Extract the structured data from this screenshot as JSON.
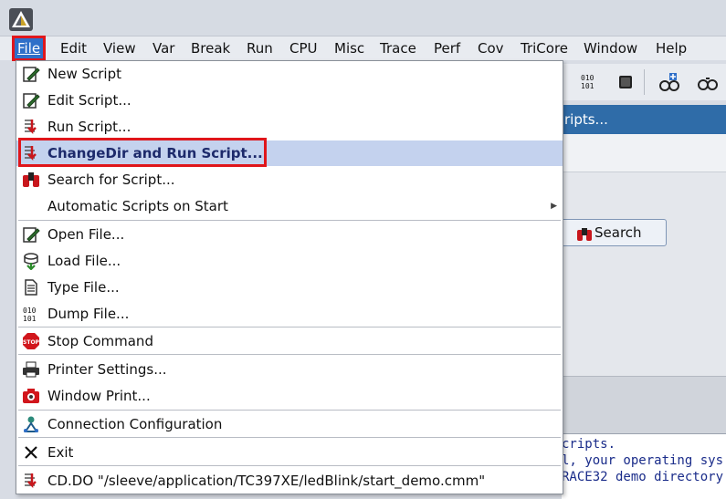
{
  "menubar": {
    "items": [
      {
        "label": "File",
        "ul": "F"
      },
      {
        "label": "Edit",
        "ul": "E"
      },
      {
        "label": "View",
        "ul": "V"
      },
      {
        "label": "Var",
        "ul": "r"
      },
      {
        "label": "Break",
        "ul": "B"
      },
      {
        "label": "Run",
        "ul": "R"
      },
      {
        "label": "CPU",
        "ul": "C"
      },
      {
        "label": "Misc",
        "ul": "M"
      },
      {
        "label": "Trace",
        "ul": "T"
      },
      {
        "label": "Perf",
        "ul": "P"
      },
      {
        "label": "Cov",
        "ul": "o"
      },
      {
        "label": "TriCore",
        "ul": ""
      },
      {
        "label": "Window",
        "ul": "W"
      },
      {
        "label": "Help",
        "ul": "H"
      }
    ]
  },
  "toolbar": {
    "dump_icon_text": "010\n101"
  },
  "background": {
    "subwindow_title": "ripts...",
    "search_button": "Search",
    "console_lines": [
      "cripts.",
      "l, your operating sys",
      "RACE32 demo directory"
    ]
  },
  "file_menu": {
    "items": [
      {
        "label": "New Script",
        "ul": "N",
        "icon": "edit-pencil-icon"
      },
      {
        "label": "Edit Script...",
        "ul": "E",
        "icon": "edit-pencil-icon"
      },
      {
        "label": "Run Script...",
        "ul": "R",
        "icon": "run-script-icon"
      },
      {
        "label": "ChangeDir and Run Script...",
        "ul": "C",
        "icon": "run-script-icon",
        "selected": true
      },
      {
        "label": "Search for Script...",
        "ul": "S",
        "icon": "binoculars-icon"
      },
      {
        "label": "Automatic Scripts on Start",
        "ul": "",
        "icon": "",
        "submenu": true
      },
      {
        "label": "Open File...",
        "ul": "",
        "icon": "edit-pencil-icon"
      },
      {
        "label": "Load File...",
        "ul": "L",
        "icon": "load-file-icon"
      },
      {
        "label": "Type File...",
        "ul": "T",
        "icon": "type-file-icon"
      },
      {
        "label": "Dump File...",
        "ul": "u",
        "icon": "dump-file-icon"
      },
      {
        "label": "Stop Command",
        "ul": "",
        "icon": "stop-icon"
      },
      {
        "label": "Printer Settings...",
        "ul": "",
        "icon": "printer-icon"
      },
      {
        "label": "Window Print...",
        "ul": "",
        "icon": "camera-icon"
      },
      {
        "label": "Connection Configuration",
        "ul": "",
        "icon": "connection-icon"
      },
      {
        "label": "Exit",
        "ul": "x",
        "icon": "close-icon"
      },
      {
        "label": "CD.DO \"/sleeve/application/TC397XE/ledBlink/start_demo.cmm\"",
        "ul": "",
        "icon": "run-script-icon"
      }
    ]
  },
  "colors": {
    "accent": "#2f6fc8",
    "highlight_outline": "#e0161b",
    "selected_row": "#c4d2ee"
  }
}
